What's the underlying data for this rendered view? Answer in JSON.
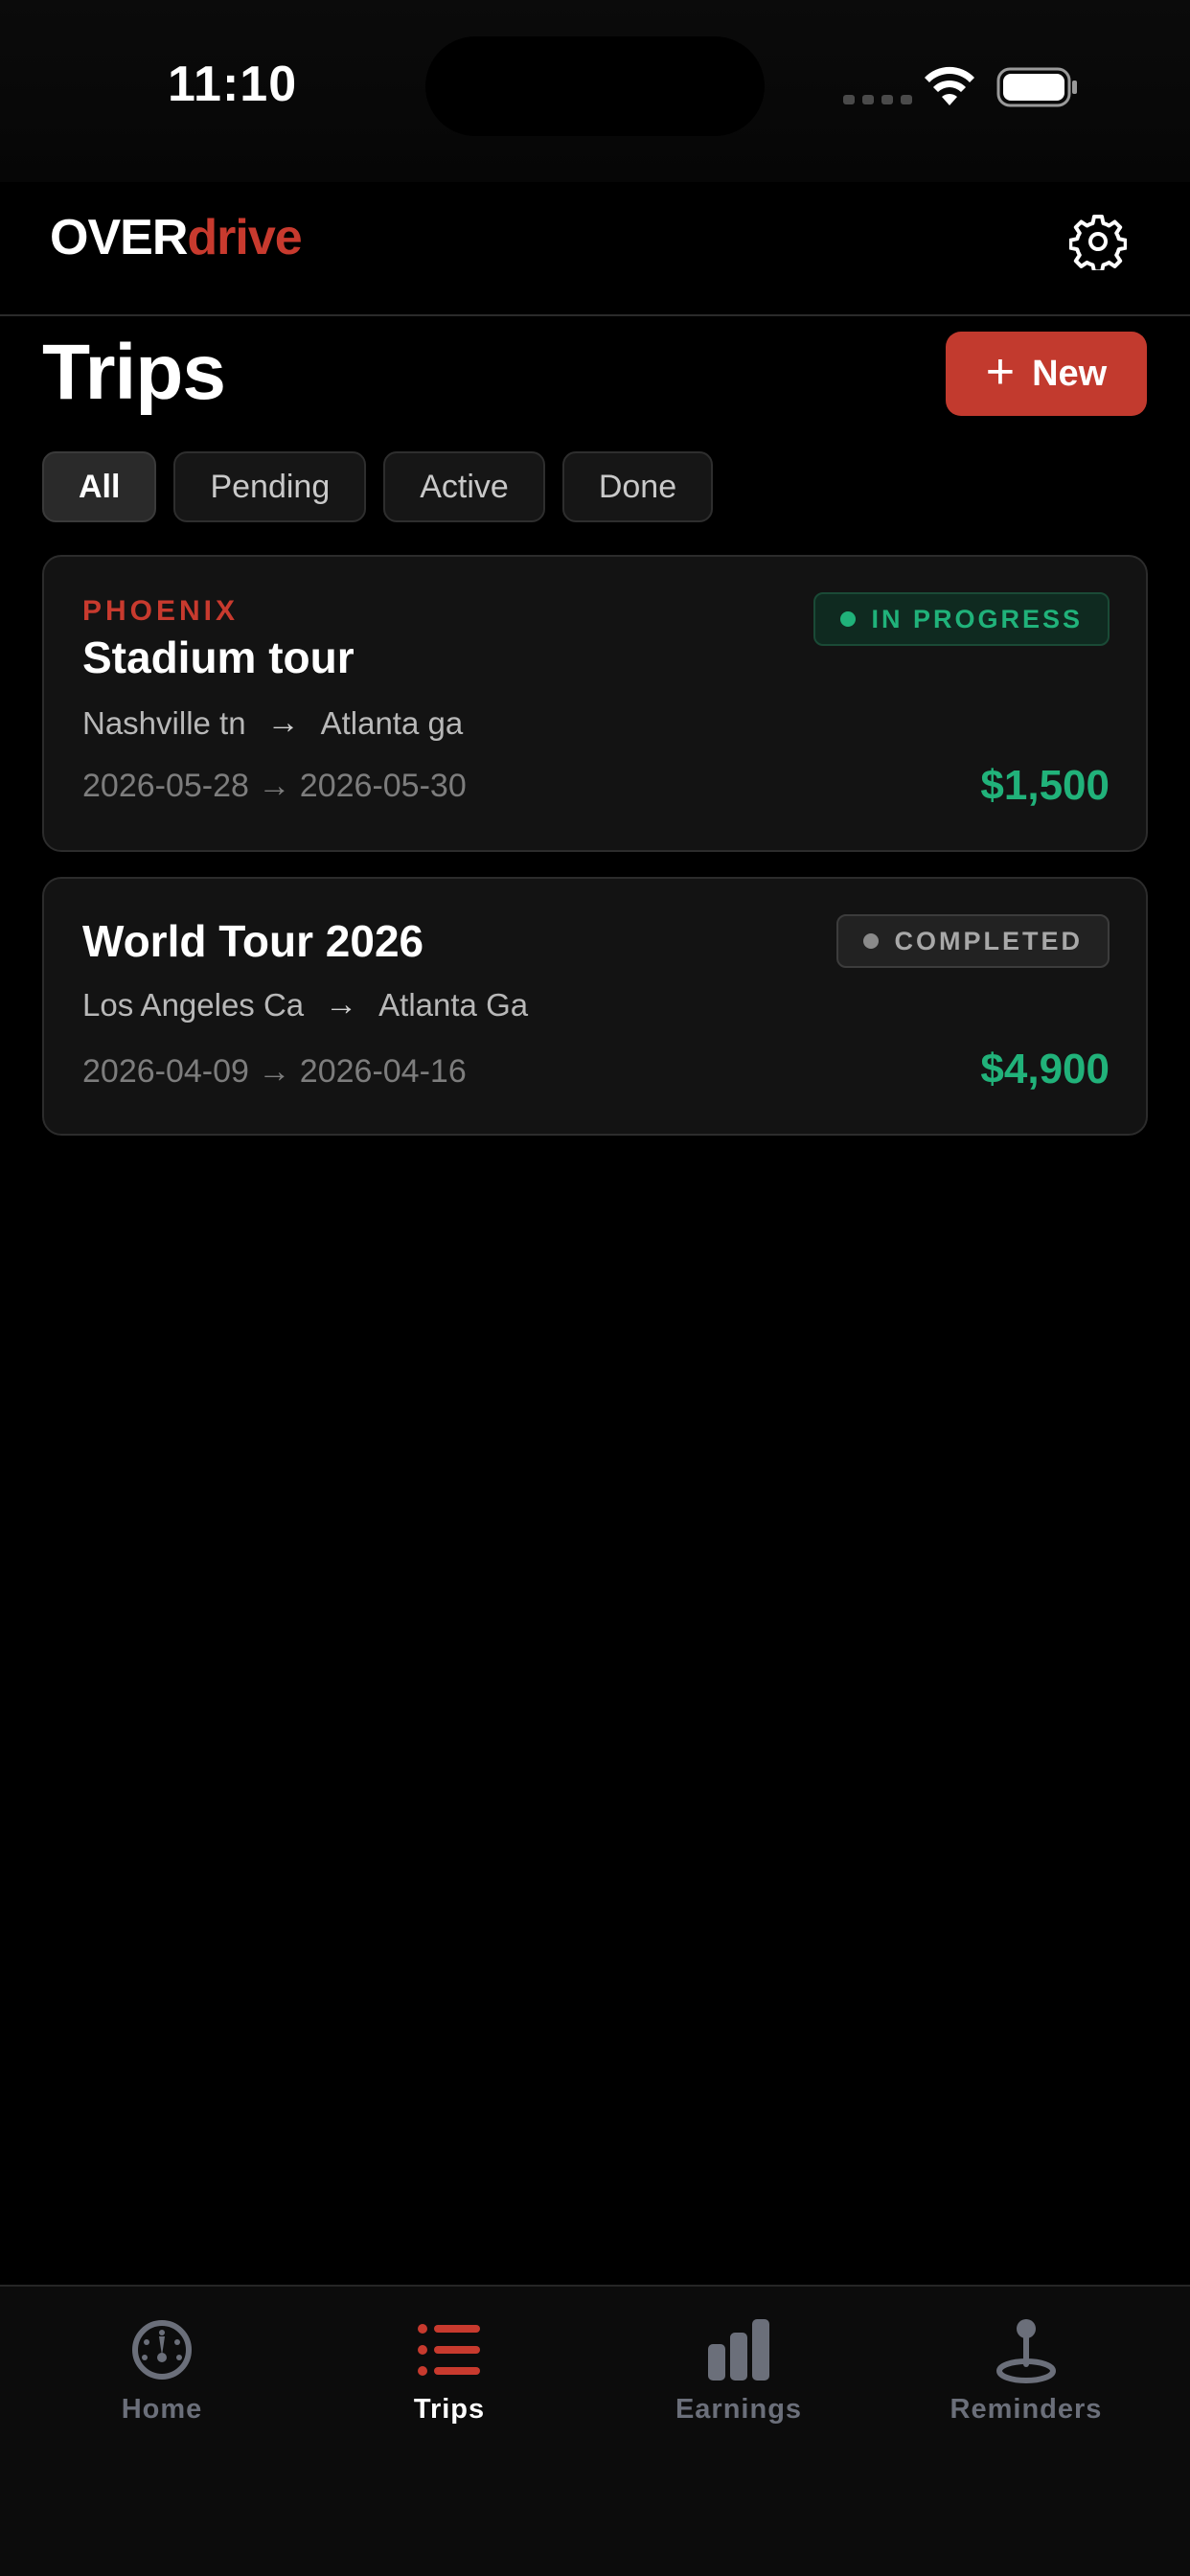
{
  "status_bar": {
    "time": "11:10"
  },
  "header": {
    "brand_part1": "OVER",
    "brand_part2": "drive",
    "settings_icon": "gear-icon"
  },
  "page": {
    "title": "Trips",
    "new_button_label": "New",
    "new_button_icon": "plus-icon"
  },
  "filters": [
    {
      "label": "All",
      "active": true
    },
    {
      "label": "Pending",
      "active": false
    },
    {
      "label": "Active",
      "active": false
    },
    {
      "label": "Done",
      "active": false
    }
  ],
  "trips": [
    {
      "client": "PHOENIX",
      "title": "Stadium tour",
      "from": "Nashville tn",
      "to": "Atlanta ga",
      "dates": "2026-05-28 → 2026-05-30",
      "price": "$1,500",
      "status": "IN PROGRESS"
    },
    {
      "client": "",
      "title": "World Tour 2026",
      "from": "Los Angeles Ca",
      "to": "Atlanta Ga",
      "dates": "2026-04-09 → 2026-04-16",
      "price": "$4,900",
      "status": "COMPLETED"
    }
  ],
  "tabs": [
    {
      "label": "Home",
      "icon": "speedometer-icon",
      "active": false
    },
    {
      "label": "Trips",
      "icon": "list-icon",
      "active": true
    },
    {
      "label": "Earnings",
      "icon": "bar-chart-icon",
      "active": false
    },
    {
      "label": "Reminders",
      "icon": "pin-icon",
      "active": false
    }
  ],
  "colors": {
    "accent": "#c83a2e",
    "success": "#21b27a",
    "inactive_tab": "#6b6f7a"
  }
}
